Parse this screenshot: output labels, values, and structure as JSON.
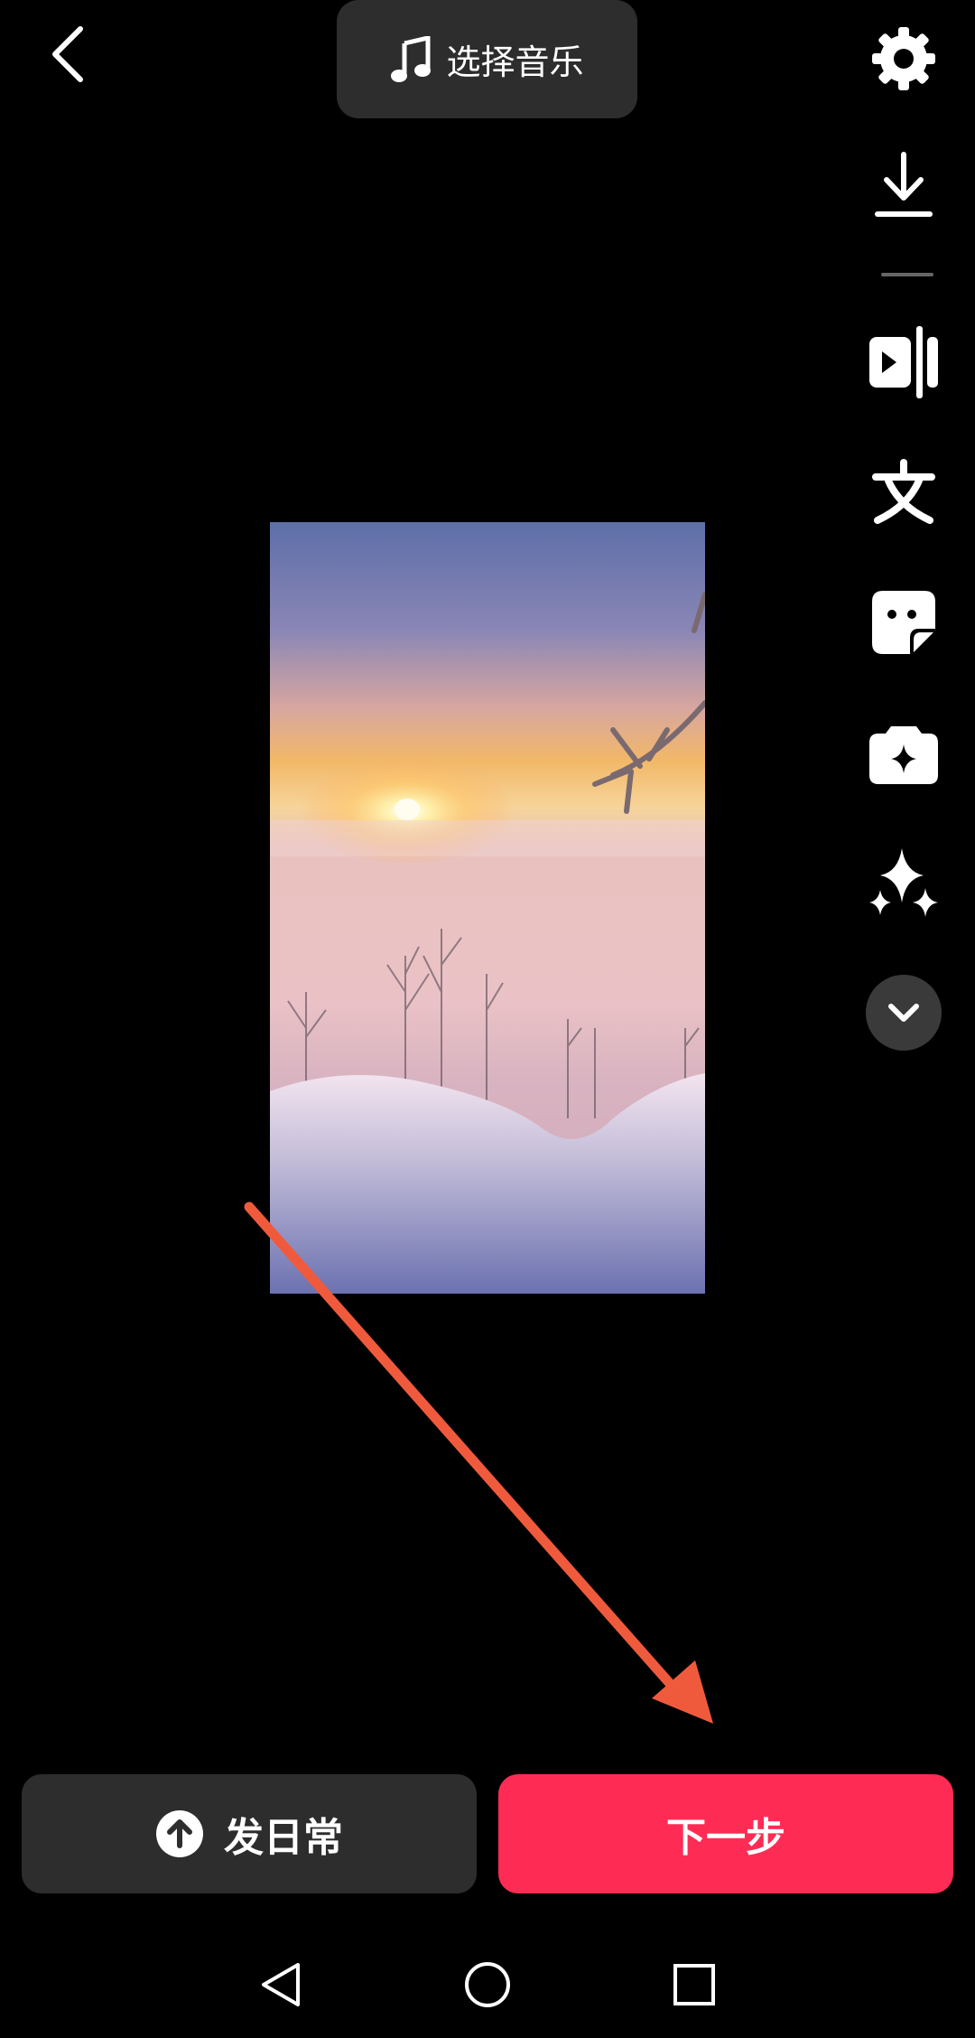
{
  "top": {
    "music_label": "选择音乐"
  },
  "toolbar": {
    "icons": [
      "gear-icon",
      "download-icon",
      "trim-icon",
      "text-icon",
      "sticker-icon",
      "effects-icon",
      "sparkle-icon",
      "chevron-down-icon"
    ]
  },
  "bottom": {
    "daily_label": "发日常",
    "next_label": "下一步"
  },
  "colors": {
    "accent": "#fe2c55",
    "pill_bg": "#2d2d2d",
    "annotation_arrow": "#f05a3c"
  }
}
